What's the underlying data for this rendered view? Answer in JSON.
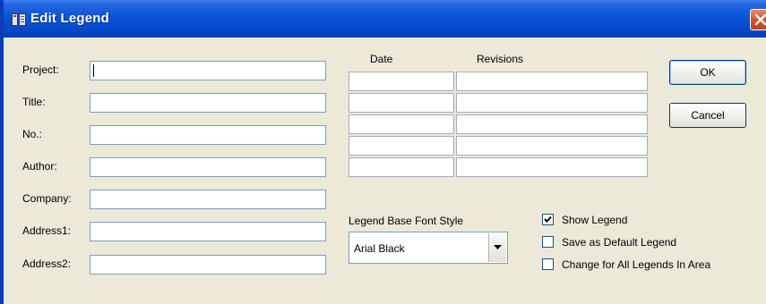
{
  "window": {
    "title": "Edit Legend"
  },
  "form": {
    "project_label": "Project:",
    "project_value": "",
    "title_label": "Title:",
    "title_value": "",
    "no_label": "No.:",
    "no_value": "",
    "author_label": "Author:",
    "author_value": "",
    "company_label": "Company:",
    "company_value": "",
    "address1_label": "Address1:",
    "address1_value": "",
    "address2_label": "Address2:",
    "address2_value": ""
  },
  "revisions": {
    "date_header": "Date",
    "revisions_header": "Revisions",
    "rows": [
      {
        "date": "",
        "revision": ""
      },
      {
        "date": "",
        "revision": ""
      },
      {
        "date": "",
        "revision": ""
      },
      {
        "date": "",
        "revision": ""
      },
      {
        "date": "",
        "revision": ""
      }
    ]
  },
  "font_style": {
    "label": "Legend Base Font Style",
    "selected": "Arial Black"
  },
  "options": {
    "show_legend": {
      "label": "Show Legend",
      "checked": true
    },
    "save_default": {
      "label": "Save as Default Legend",
      "checked": false
    },
    "change_all": {
      "label": "Change for All Legends In Area",
      "checked": false
    }
  },
  "buttons": {
    "ok": "OK",
    "cancel": "Cancel"
  },
  "colors": {
    "titlebar": "#0a54d8",
    "dialog_bg": "#ece9d8",
    "close": "#d7532d"
  }
}
